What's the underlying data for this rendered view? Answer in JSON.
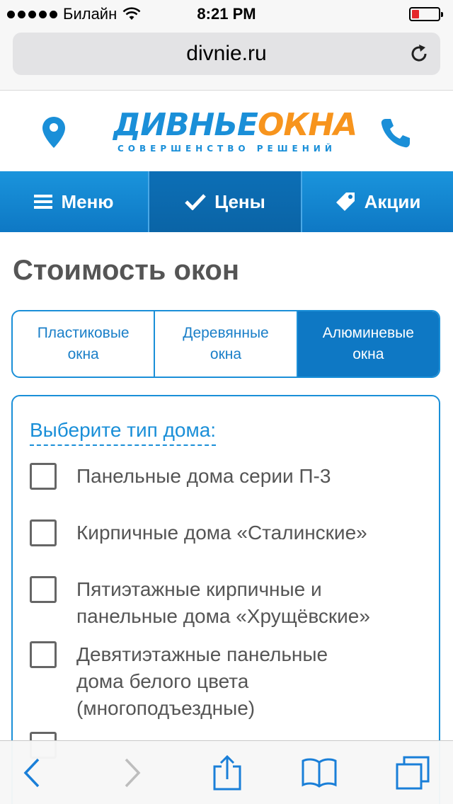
{
  "status_bar": {
    "carrier": "Билайн",
    "time": "8:21 PM",
    "battery_level": 0.25,
    "battery_color": "#e5262b"
  },
  "browser": {
    "url": "divnie.ru",
    "reload_icon": "reload-icon"
  },
  "header": {
    "logo_part1": "ДИВНЬЕ",
    "logo_part2": "ОКНА",
    "logo_tagline": "СОВЕРШЕНСТВО РЕШЕНИЙ",
    "location_icon": "map-pin-icon",
    "phone_icon": "phone-icon",
    "brand_blue": "#1a8fd8",
    "brand_orange": "#f7941d"
  },
  "nav": {
    "items": [
      {
        "label": "Меню",
        "icon": "hamburger-icon",
        "active": false
      },
      {
        "label": "Цены",
        "icon": "checkmark-icon",
        "active": true
      },
      {
        "label": "Акции",
        "icon": "tag-icon",
        "active": false
      }
    ]
  },
  "main": {
    "title": "Стоимость окон",
    "tabs": [
      {
        "line1": "Пластиковые",
        "line2": "окна",
        "active": false
      },
      {
        "line1": "Деревянные",
        "line2": "окна",
        "active": false
      },
      {
        "line1": "Алюминевые",
        "line2": "окна",
        "active": true
      }
    ],
    "form": {
      "heading": "Выберите тип дома:",
      "options": [
        {
          "line1": "Панельные дома серии П-3",
          "line2": "",
          "line3": "",
          "checked": false
        },
        {
          "line1": "Кирпичные дома «Сталинские»",
          "line2": "",
          "line3": "",
          "checked": false
        },
        {
          "line1": "Пятиэтажные кирпичные и",
          "line2": "панельные дома «Хрущёвские»",
          "line3": "",
          "checked": false
        },
        {
          "line1": "Девятиэтажные панельные",
          "line2": "дома белого цвета",
          "line3": "(многоподъездные)",
          "checked": false
        }
      ]
    }
  },
  "toolbar": {
    "buttons": [
      "back-icon",
      "forward-icon",
      "share-icon",
      "bookmarks-icon",
      "tabs-icon"
    ]
  }
}
